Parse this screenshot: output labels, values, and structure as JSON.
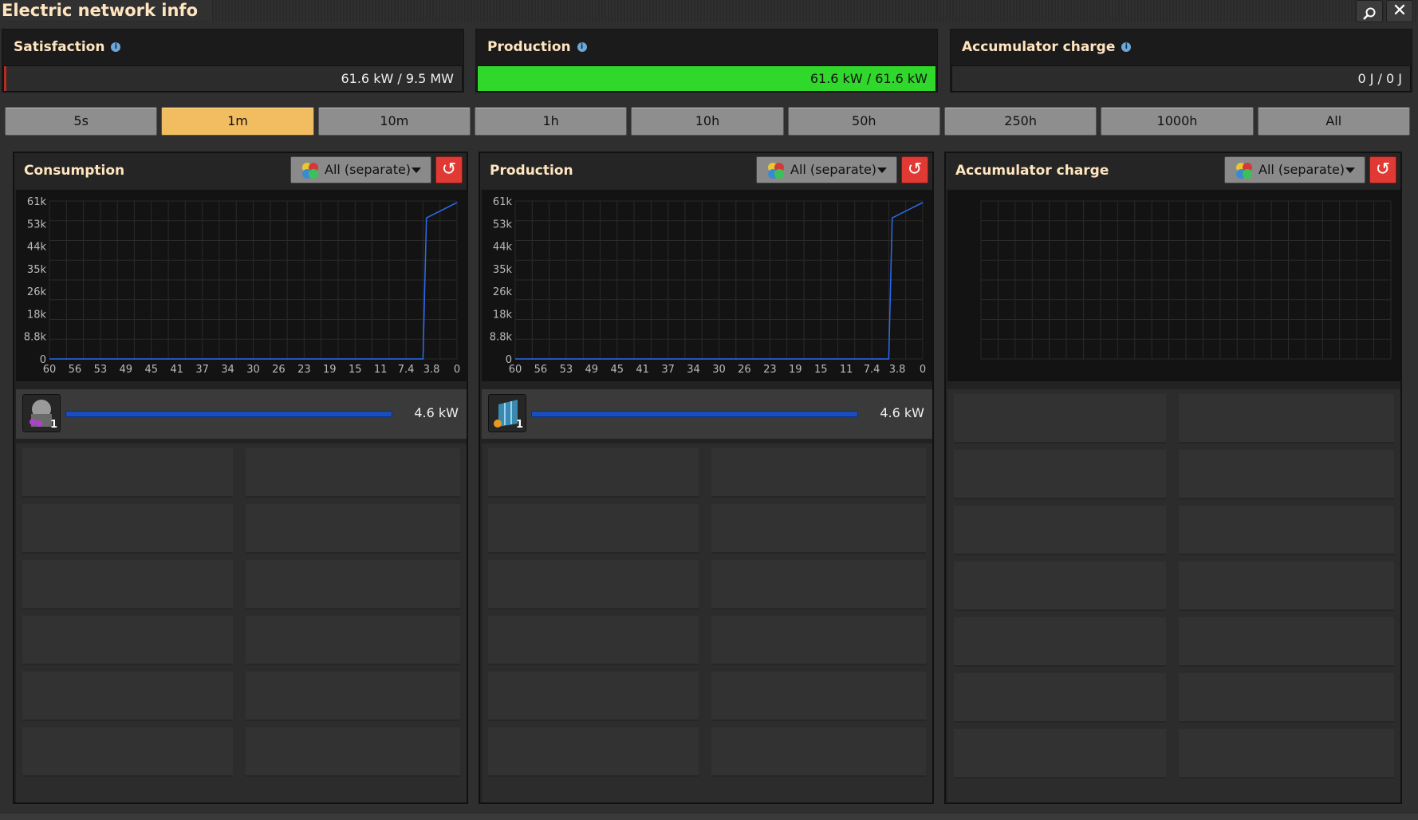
{
  "window": {
    "title": "Electric network info",
    "search_icon": "search-icon",
    "close_icon": "close-icon"
  },
  "stats": [
    {
      "label": "Satisfaction",
      "value_text": "61.6 kW / 9.5 MW",
      "fill_fraction": 0.0065,
      "fill_color": "#b92a20"
    },
    {
      "label": "Production",
      "value_text": "61.6 kW / 61.6 kW",
      "fill_fraction": 1.0,
      "fill_color": "#2fd82a"
    },
    {
      "label": "Accumulator charge",
      "value_text": "0 J / 0 J",
      "fill_fraction": 0,
      "fill_color": "#2fd82a"
    }
  ],
  "time_tabs": {
    "items": [
      "5s",
      "1m",
      "10m",
      "1h",
      "10h",
      "50h",
      "250h",
      "1000h",
      "All"
    ],
    "selected": "1m"
  },
  "panels": [
    {
      "title": "Consumption",
      "filter": "All (separate)",
      "entity_value": "4.6 kW",
      "entity_icon": "lab-icon",
      "entity_count": "1"
    },
    {
      "title": "Production",
      "filter": "All (separate)",
      "entity_value": "4.6 kW",
      "entity_icon": "solar-panel-icon",
      "entity_count": "1"
    },
    {
      "title": "Accumulator charge",
      "filter": "All (separate)"
    }
  ],
  "chart_data": [
    {
      "type": "line",
      "y_tick_labels": [
        "61k",
        "53k",
        "44k",
        "35k",
        "26k",
        "18k",
        "8.8k",
        "0"
      ],
      "x_tick_labels": [
        "60",
        "56",
        "53",
        "49",
        "45",
        "41",
        "37",
        "34",
        "30",
        "26",
        "23",
        "19",
        "15",
        "11",
        "7.4",
        "3.8",
        "0"
      ],
      "ylim": [
        0,
        61600
      ],
      "xlim": [
        60,
        0
      ],
      "series": [
        {
          "color": "#2a6cf0",
          "x": [
            60,
            5.0,
            4.5,
            0
          ],
          "y": [
            0,
            0,
            55000,
            61000
          ]
        }
      ],
      "grid": true
    },
    {
      "type": "line",
      "y_tick_labels": [
        "61k",
        "53k",
        "44k",
        "35k",
        "26k",
        "18k",
        "8.8k",
        "0"
      ],
      "x_tick_labels": [
        "60",
        "56",
        "53",
        "49",
        "45",
        "41",
        "37",
        "34",
        "30",
        "26",
        "23",
        "19",
        "15",
        "11",
        "7.4",
        "3.8",
        "0"
      ],
      "ylim": [
        0,
        61600
      ],
      "xlim": [
        60,
        0
      ],
      "series": [
        {
          "color": "#2a6cf0",
          "x": [
            60,
            5.0,
            4.5,
            0
          ],
          "y": [
            0,
            0,
            55000,
            61000
          ]
        }
      ],
      "grid": true
    },
    {
      "type": "line",
      "y_tick_labels": [],
      "x_tick_labels": [],
      "series": [],
      "grid": true
    }
  ]
}
